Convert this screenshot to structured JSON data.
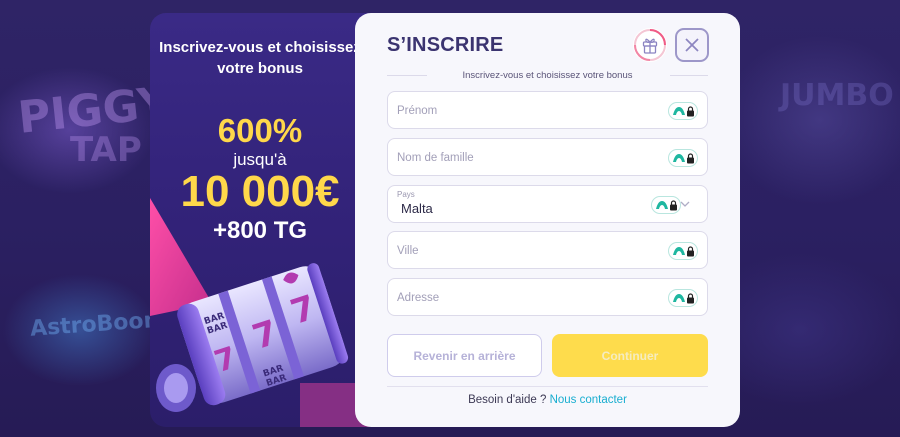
{
  "background": {
    "games": [
      "PIGGY",
      "TAP",
      "AstroBoom",
      "JUMBO"
    ]
  },
  "promo": {
    "heading": "Inscrivez-vous et choisissez votre bonus",
    "percent": "600%",
    "up_to": "jusqu'à",
    "amount": "10 000€",
    "extra": "+800 TG",
    "reel_labels": [
      "BAR",
      "BAR",
      "BAR",
      "BAR"
    ]
  },
  "form": {
    "title": "S’INSCRIRE",
    "subtitle": "Inscrivez-vous et choisissez votre bonus",
    "fields": {
      "first_name": {
        "placeholder": "Prénom"
      },
      "last_name": {
        "placeholder": "Nom de famille"
      },
      "country": {
        "label": "Pays",
        "value": "Malta"
      },
      "city": {
        "placeholder": "Ville"
      },
      "address": {
        "placeholder": "Adresse"
      }
    },
    "buttons": {
      "back": "Revenir en arrière",
      "continue": "Continuer"
    },
    "help": {
      "text": "Besoin d'aide ?",
      "link": "Nous contacter"
    }
  },
  "colors": {
    "accent_yellow": "#fedc4c",
    "link": "#19aed0",
    "title": "#3b3470",
    "promo_highlight": "#ffd84a"
  },
  "icons": [
    "gift-icon",
    "close-icon",
    "lock-icon",
    "chevron-down-icon"
  ]
}
